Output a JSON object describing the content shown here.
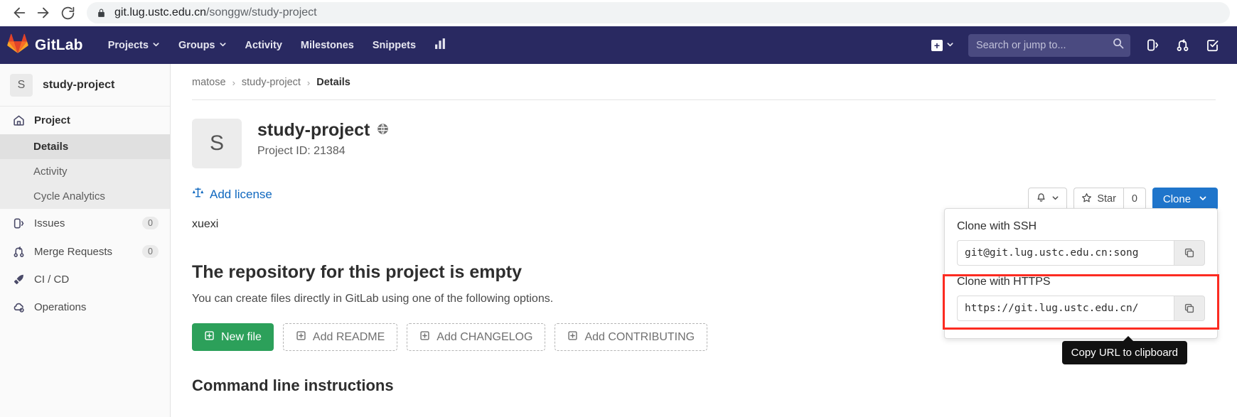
{
  "browser": {
    "back_icon": "back-arrow-icon",
    "forward_icon": "forward-arrow-icon",
    "reload_icon": "reload-icon",
    "lock_icon": "lock-icon",
    "url_host": "git.lug.ustc.edu.cn",
    "url_path": "/songgw/study-project",
    "url_full": "git.lug.ustc.edu.cn/songgw/study-project"
  },
  "navbar": {
    "brand": "GitLab",
    "brand_icon": "gitlab-tanuki-icon",
    "items": [
      {
        "label": "Projects",
        "has_caret": true
      },
      {
        "label": "Groups",
        "has_caret": true
      },
      {
        "label": "Activity",
        "has_caret": false
      },
      {
        "label": "Milestones",
        "has_caret": false
      },
      {
        "label": "Snippets",
        "has_caret": false
      }
    ],
    "analytics_icon": "chart-bar-icon",
    "plus_label": "+",
    "plus_caret": "⌄",
    "search_placeholder": "Search or jump to...",
    "search_value": "",
    "search_icon": "search-icon",
    "right_icons": [
      "issues-icon",
      "merge-requests-icon",
      "todos-done-icon"
    ],
    "background": "#292961"
  },
  "sidebar": {
    "avatar_letter": "S",
    "project_name": "study-project",
    "items": [
      {
        "label": "Project",
        "icon": "home-icon",
        "type": "top"
      },
      {
        "label": "Details",
        "type": "sub",
        "active": true
      },
      {
        "label": "Activity",
        "type": "sub",
        "active": false
      },
      {
        "label": "Cycle Analytics",
        "type": "sub",
        "active": false
      },
      {
        "label": "Issues",
        "icon": "issues-icon",
        "type": "top",
        "count": "0"
      },
      {
        "label": "Merge Requests",
        "icon": "merge-requests-icon",
        "type": "top",
        "count": "0"
      },
      {
        "label": "CI / CD",
        "icon": "rocket-icon",
        "type": "top"
      },
      {
        "label": "Operations",
        "icon": "cloud-gear-icon",
        "type": "top"
      }
    ]
  },
  "breadcrumb": {
    "items": [
      "matose",
      "study-project",
      "Details"
    ],
    "separator": "›"
  },
  "project": {
    "avatar_letter": "S",
    "title": "study-project",
    "visibility_icon": "globe-public-icon",
    "project_id": "Project ID: 21384",
    "license_link": "Add license",
    "license_icon": "scales-balance-icon",
    "description": "xuexi"
  },
  "actions": {
    "notification_icon": "bell-icon",
    "notification_caret": "⌄",
    "star_icon": "star-icon",
    "star_label": "Star",
    "star_count": "0",
    "clone_label": "Clone",
    "clone_caret": "⌄",
    "clone_color": "#1f75cb"
  },
  "empty_repo": {
    "title": "The repository for this project is empty",
    "subtitle": "You can create files directly in GitLab using one of the following options.",
    "buttons": [
      {
        "label": "New file",
        "style": "primary",
        "icon": "new-file-icon"
      },
      {
        "label": "Add README",
        "style": "dashed",
        "icon": "add-file-icon"
      },
      {
        "label": "Add CHANGELOG",
        "style": "dashed",
        "icon": "add-file-icon"
      },
      {
        "label": "Add CONTRIBUTING",
        "style": "dashed",
        "icon": "add-file-icon"
      }
    ],
    "cli_title": "Command line instructions"
  },
  "clone_panel": {
    "ssh_label": "Clone with SSH",
    "ssh_url": "git@git.lug.ustc.edu.cn:song",
    "https_label": "Clone with HTTPS",
    "https_url": "https://git.lug.ustc.edu.cn/",
    "copy_icon": "copy-to-clipboard-icon",
    "highlight_color": "#fc2b21"
  },
  "tooltip": {
    "text": "Copy URL to clipboard"
  }
}
